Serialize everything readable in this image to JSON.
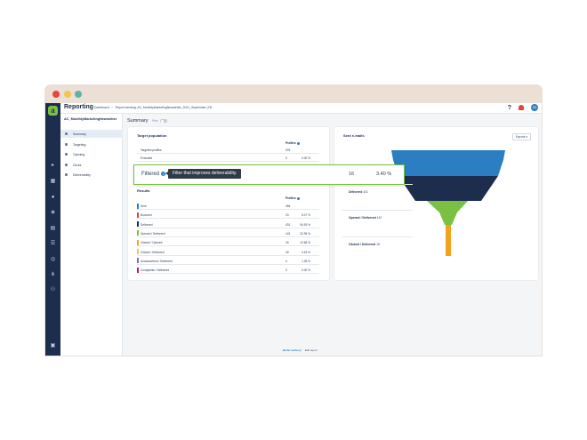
{
  "window": {
    "title": "Reporting"
  },
  "breadcrumbs": [
    "Dashboard",
    "Report sending: AC_MonthlyMarketingNewsletter_2021_September_EN"
  ],
  "topbar": {
    "avatar_initials": "SD"
  },
  "campaign_name": "AC_MonthlyMarketingNewsletter",
  "subnav": [
    {
      "label": "Summary",
      "active": true
    },
    {
      "label": "Targeting",
      "active": false
    },
    {
      "label": "Opening",
      "active": false
    },
    {
      "label": "Clicks",
      "active": false
    },
    {
      "label": "Deliverability",
      "active": false
    }
  ],
  "main": {
    "summary_title": "Summary",
    "print_label": "Print"
  },
  "target_population": {
    "title": "Target population",
    "col_head": "Profiles",
    "rows": [
      {
        "label": "Targeted profiles",
        "value": "476",
        "pct": ""
      },
      {
        "label": "Excluded",
        "value": "0",
        "pct": "0.00 %"
      }
    ]
  },
  "results": {
    "title": "Results",
    "col_head": "Profiles",
    "rows": [
      {
        "label": "Sent",
        "value": "454",
        "pct": "",
        "color": "#2c7ec3"
      },
      {
        "label": "Bounced",
        "value": "23",
        "pct": "5.07 %",
        "color": "#e2433d"
      },
      {
        "label": "Delivered",
        "value": "431",
        "pct": "94.93 %",
        "color": "#1c2d4d"
      },
      {
        "label": "Opened / Delivered",
        "value": "142",
        "pct": "32.95 %",
        "color": "#7ac143"
      },
      {
        "label": "Clicked / Opened",
        "value": "18",
        "pct": "12.68 %",
        "color": "#f3a31b"
      },
      {
        "label": "Clicked / Delivered",
        "value": "18",
        "pct": "4.18 %",
        "color": "#f3c74a"
      },
      {
        "label": "Unsubscribed / Delivered",
        "value": "4",
        "pct": "1.28 %",
        "color": "#8a6db5"
      },
      {
        "label": "Complaints / Delivered",
        "value": "0",
        "pct": "0.00 %",
        "color": "#c2185b"
      }
    ]
  },
  "sent_emails": {
    "title": "Sent e-mails",
    "exports_label": "Exports",
    "funnel": [
      {
        "label": "Delivered",
        "value": "431"
      },
      {
        "label": "Opened / Delivered",
        "value": "142"
      },
      {
        "label": "Clicked / Delivered",
        "value": "18"
      }
    ],
    "colors": {
      "sent": "#2c7ec3",
      "delivered": "#1c2d4d",
      "opened": "#7ac143",
      "clicked": "#f3a31b"
    }
  },
  "highlight": {
    "label": "Filtered",
    "tooltip": "Filter that improves deliverability.",
    "value": "16",
    "pct": "3.40 %"
  },
  "footer": {
    "link": "Better delivery",
    "text": "Edit report"
  }
}
